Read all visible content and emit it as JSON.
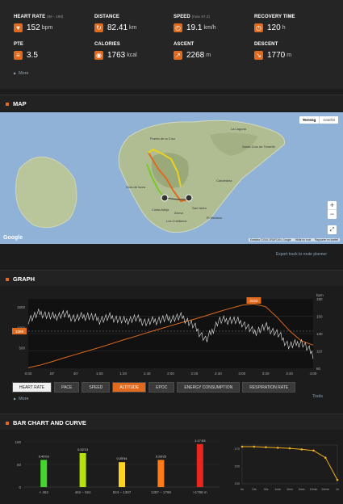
{
  "stats": [
    {
      "label": "HEART RATE",
      "sub": "(96 - 198)",
      "value": "152",
      "unit": "bpm",
      "icon": "heart-icon",
      "glyph": "♥"
    },
    {
      "label": "DISTANCE",
      "sub": "",
      "value": "82.41",
      "unit": "km",
      "icon": "distance-icon",
      "glyph": "↻"
    },
    {
      "label": "SPEED",
      "sub": "(max 57.2)",
      "value": "19.1",
      "unit": "km/h",
      "icon": "speed-icon",
      "glyph": "◴"
    },
    {
      "label": "RECOVERY TIME",
      "sub": "",
      "value": "120",
      "unit": "h",
      "icon": "recovery-icon",
      "glyph": "◷"
    },
    {
      "label": "PTE",
      "sub": "",
      "value": "3.5",
      "unit": "",
      "icon": "pte-icon",
      "glyph": "≡"
    },
    {
      "label": "CALORIES",
      "sub": "",
      "value": "1763",
      "unit": "kcal",
      "icon": "calories-icon",
      "glyph": "◉"
    },
    {
      "label": "ASCENT",
      "sub": "",
      "value": "2268",
      "unit": "m",
      "icon": "ascent-icon",
      "glyph": "↗"
    },
    {
      "label": "DESCENT",
      "sub": "",
      "value": "1770",
      "unit": "m",
      "icon": "descent-icon",
      "glyph": "↘"
    }
  ],
  "more_label": "More",
  "sections": {
    "map": "MAP",
    "graph": "GRAPH",
    "bars": "BAR CHART AND CURVE"
  },
  "map": {
    "terrain": "Terreng",
    "satellite": "Satellitt",
    "places": [
      "Puerto de la Cruz",
      "La Laguna",
      "Santa Cruz de Tenerife",
      "Los Cristianos",
      "Costa Adeje",
      "San Isidro",
      "Candelaria",
      "Arona",
      "El Medano",
      "Guia de Isora"
    ],
    "attribution": "Kartdata ©2016 GRAFCAN, Google",
    "terms": "Vilkår for bruk",
    "report": "Rapporter en kartfeil",
    "google": "Google",
    "zoom_in": "+",
    "zoom_out": "−",
    "fullscreen": "⤢"
  },
  "export_link": "Export track to route planner",
  "chart_data": [
    {
      "type": "line",
      "title": "",
      "x_tick_labels": [
        "0:00",
        "20'",
        "40'",
        "1:00",
        "1:20",
        "1:40",
        "2:00",
        "2:20",
        "2:40",
        "3:00",
        "3:20",
        "3:40",
        "4:00"
      ],
      "ylabel_left_ticks": [
        "500",
        "1000",
        "1500"
      ],
      "ylabel_right_ticks": [
        "80",
        "110",
        "130",
        "150",
        "180"
      ],
      "ylabel_right_unit": "bpm",
      "marker_altitude": "1069",
      "marker_max": "2222",
      "series": [
        {
          "name": "",
          "color": "#e06a1e",
          "values": [
            20,
            110,
            230,
            360,
            480,
            600,
            720,
            850,
            980,
            1100,
            1230,
            1350,
            1470,
            1590,
            1700,
            1820,
            1950,
            2070,
            2180,
            2222,
            2130,
            1750,
            1300,
            950,
            800
          ]
        },
        {
          "name": "",
          "color": "#e8e8e8",
          "values": [
            150,
            160,
            154,
            158,
            152,
            156,
            150,
            154,
            148,
            152,
            146,
            150,
            152,
            154,
            140,
            120,
            148,
            150,
            146,
            132,
            140,
            130,
            112,
            118,
            100
          ]
        }
      ]
    },
    {
      "type": "bar",
      "title": "",
      "categories": [
        "< 462",
        "462 – 924",
        "924 – 1387",
        "1387 – 1798",
        ">1798 m"
      ],
      "values": [
        0.6,
        0.75,
        0.55,
        0.6,
        0.95
      ],
      "value_labels": [
        "0:40'03",
        "0:32'13",
        "0:25'54",
        "0:28'25",
        "1:17:53"
      ],
      "colors": [
        "#44d62c",
        "#b8e20c",
        "#ffd21e",
        "#ff7b1a",
        "#e8261d"
      ],
      "ylim": [
        0,
        100
      ],
      "y_ticks": [
        "0",
        "50",
        "100"
      ]
    },
    {
      "type": "line",
      "title": "",
      "x": [
        "0s",
        "10s",
        "30s",
        "1min",
        "3min",
        "5min",
        "10min",
        "20min",
        "1h"
      ],
      "values": [
        170,
        170,
        169,
        168,
        167,
        165,
        163,
        150,
        110
      ],
      "y_ticks": [
        "170",
        "150",
        "130"
      ],
      "color": "#f0b020"
    }
  ],
  "graph_tabs": [
    "HEART RATE",
    "PACE",
    "SPEED",
    "ALTITUDE",
    "EPOC",
    "ENERGY CONSUMPTION",
    "RESPIRATION RATE"
  ],
  "tools_label": "Tools"
}
